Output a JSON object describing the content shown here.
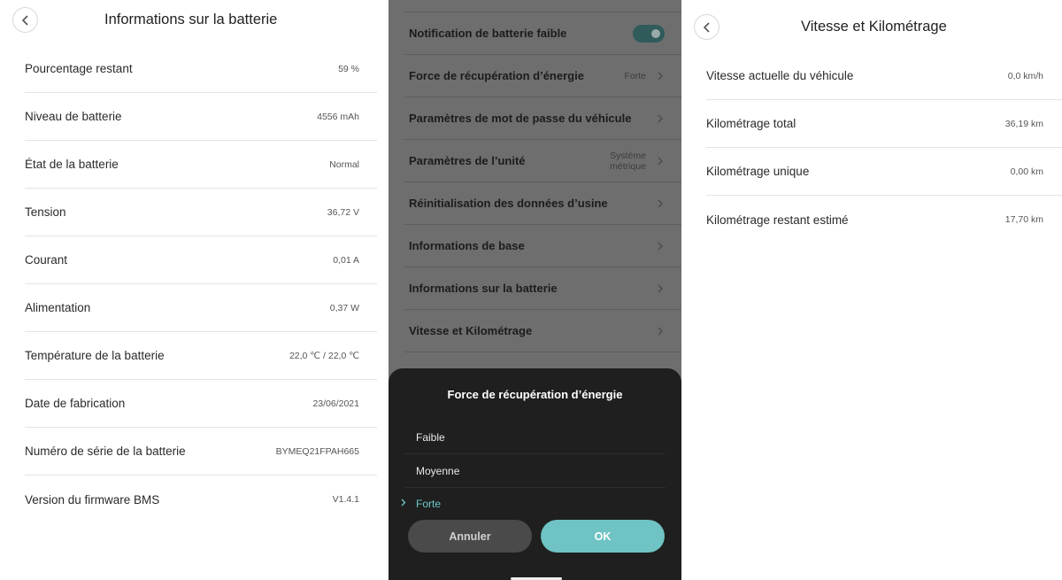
{
  "battery_info": {
    "title": "Informations sur la batterie",
    "rows": [
      {
        "label": "Pourcentage restant",
        "value": "59 %"
      },
      {
        "label": "Niveau de batterie",
        "value": "4556 mAh"
      },
      {
        "label": "État de la batterie",
        "value": "Normal"
      },
      {
        "label": "Tension",
        "value": "36,72 V"
      },
      {
        "label": "Courant",
        "value": "0,01 A"
      },
      {
        "label": "Alimentation",
        "value": "0,37 W"
      },
      {
        "label": "Température de la batterie",
        "value": "22,0 ℃ / 22,0 ℃"
      },
      {
        "label": "Date de fabrication",
        "value": "23/06/2021"
      },
      {
        "label": "Numéro de série de la batterie",
        "value": "BYMEQ21FPAH665"
      },
      {
        "label": "Version du firmware BMS",
        "value": "V1.4.1"
      }
    ]
  },
  "settings": {
    "items": [
      {
        "label": "Notification de batterie faible",
        "toggle_on": true
      },
      {
        "label": "Force de récupération d’énergie",
        "value": "Forte"
      },
      {
        "label": "Paramètres de mot de passe du véhicule"
      },
      {
        "label": "Paramètres de l’unité",
        "value_line1": "Système",
        "value_line2": "métrique"
      },
      {
        "label": "Réinitialisation des données d’usine"
      },
      {
        "label": "Informations de base"
      },
      {
        "label": "Informations sur la batterie"
      },
      {
        "label": "Vitesse et Kilométrage"
      }
    ],
    "sheet": {
      "title": "Force de récupération d’énergie",
      "options": [
        "Faible",
        "Moyenne",
        "Forte"
      ],
      "selected": "Forte",
      "cancel_label": "Annuler",
      "ok_label": "OK"
    }
  },
  "speed_info": {
    "title": "Vitesse et Kilométrage",
    "rows": [
      {
        "label": "Vitesse actuelle du véhicule",
        "value": "0,0 km/h"
      },
      {
        "label": "Kilométrage total",
        "value": "36,19 km"
      },
      {
        "label": "Kilométrage unique",
        "value": "0,00 km"
      },
      {
        "label": "Kilométrage restant estimé",
        "value": "17,70 km"
      }
    ]
  },
  "colors": {
    "accent": "#6fc3c4",
    "sheet_background": "#1f1f1f",
    "overlay": "#6e6e6e"
  },
  "icons": {
    "back": "chevron-left-icon",
    "row_arrow": "chevron-right-icon",
    "selected": "check-icon"
  }
}
